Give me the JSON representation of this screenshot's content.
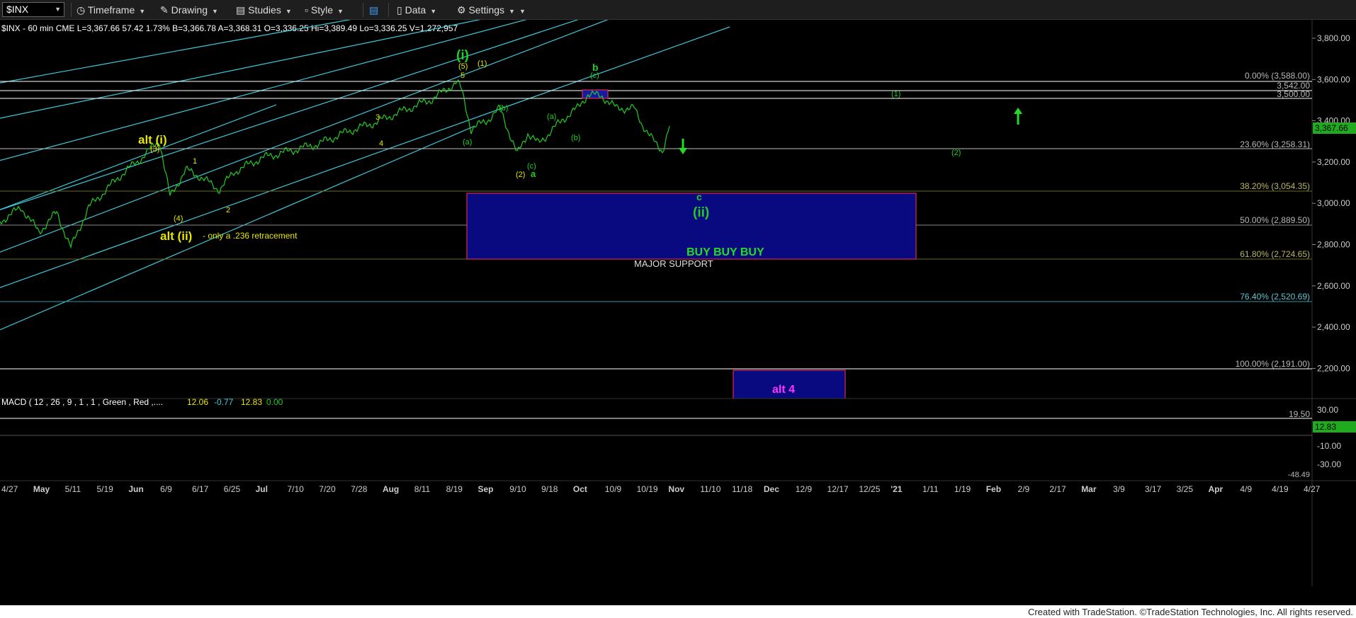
{
  "toolbar": {
    "symbol": "$INX",
    "items": [
      {
        "label": "Timeframe",
        "icon": "clock-icon"
      },
      {
        "label": "Drawing",
        "icon": "pencil-icon"
      },
      {
        "label": "Studies",
        "icon": "studies-icon"
      },
      {
        "label": "Style",
        "icon": "style-icon"
      },
      {
        "label": "",
        "icon": "layout-icon"
      },
      {
        "label": "Data",
        "icon": "data-icon"
      },
      {
        "label": "Settings",
        "icon": "gear-icon"
      }
    ]
  },
  "header": {
    "line": "$INX - 60 min  CME   L=3,367.66  57.42  1.73%  B=3,366.78  A=3,368.31  O=3,336.25  Hi=3,389.49  Lo=3,336.25  V=1,272,957"
  },
  "colors": {
    "background": "#000000",
    "price_line": "#22cc22",
    "fib_label": "#b8b8b8",
    "wave_yellow": "#e6e600",
    "wave_green": "#22cc22",
    "channel": "#3fc9d9",
    "support_box": "#0a0a80",
    "macd_fast": "#ffff66",
    "macd_slow": "#dddddd",
    "hist_up": "#22cc22",
    "hist_down": "#ee2222",
    "alt4_text": "#ff33ff"
  },
  "price_axis": {
    "ticks": [
      "3,800.00",
      "3,600.00",
      "3,400.00",
      "3,200.00",
      "3,000.00",
      "2,800.00",
      "2,600.00",
      "2,400.00",
      "2,200.00"
    ],
    "current_price": "3,367.66"
  },
  "fib_levels": [
    {
      "label": "0.00% (3,588.00)"
    },
    {
      "label": "3,542.00"
    },
    {
      "label": "3,500.00"
    },
    {
      "label": "23.60% (3,258.31)"
    },
    {
      "label": "38.20% (3,054.35)"
    },
    {
      "label": "50.00% (2,889.50)"
    },
    {
      "label": "61.80% (2,724.65)"
    },
    {
      "label": "76.40% (2,520.69)"
    },
    {
      "label": "100.00% (2,191.00)"
    }
  ],
  "annotations": {
    "alt_i": "alt (i)",
    "alt_ii": "alt (ii)",
    "alt_ii_note": "- only a .236 retracement",
    "wave_i": "(i)",
    "wave_ii": "(ii)",
    "wave_c": "c",
    "wave_b": "b",
    "wave_a": "a",
    "buy": "BUY BUY BUY",
    "major_support": "MAJOR SUPPORT",
    "alt4": "alt 4",
    "small_labels": [
      "(3)",
      "1",
      "(4)",
      "2",
      "3",
      "4",
      "(5)",
      "5",
      "(1)",
      "(a)",
      "(b)",
      "(c)",
      "(2)",
      "(a)",
      "(b)",
      "(c)",
      "(1)",
      "(2)"
    ]
  },
  "macd": {
    "label": "MACD ( 12 , 26 , 9 , 1 , 1 , Green , Red ,....",
    "v1": "12.06",
    "v2": "-0.77",
    "v3": "12.83",
    "v4": "0.00",
    "axis_ticks": [
      "30.00",
      "-10.00",
      "-30.00"
    ],
    "level_19": "19.50",
    "current": "12.83",
    "min_label": "-48.49"
  },
  "date_axis": [
    "4/27",
    "May",
    "5/11",
    "5/19",
    "Jun",
    "6/9",
    "6/17",
    "6/25",
    "Jul",
    "7/10",
    "7/20",
    "7/28",
    "Aug",
    "8/11",
    "8/19",
    "Sep",
    "9/10",
    "9/18",
    "Oct",
    "10/9",
    "10/19",
    "Nov",
    "11/10",
    "11/18",
    "Dec",
    "12/9",
    "12/17",
    "12/25",
    "'21",
    "1/11",
    "1/19",
    "Feb",
    "2/9",
    "2/17",
    "Mar",
    "3/9",
    "3/17",
    "3/25",
    "Apr",
    "4/9",
    "4/19",
    "4/27"
  ],
  "footer": "Created with TradeStation. ©TradeStation Technologies, Inc. All rights reserved."
}
